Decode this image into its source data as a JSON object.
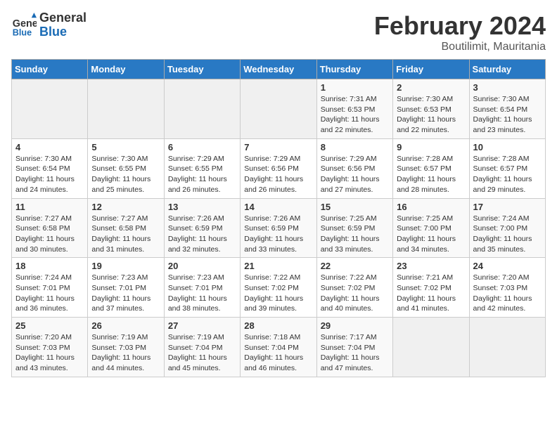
{
  "header": {
    "logo_line1": "General",
    "logo_line2": "Blue",
    "month_title": "February 2024",
    "location": "Boutilimit, Mauritania"
  },
  "days_of_week": [
    "Sunday",
    "Monday",
    "Tuesday",
    "Wednesday",
    "Thursday",
    "Friday",
    "Saturday"
  ],
  "weeks": [
    [
      {
        "day": "",
        "empty": true
      },
      {
        "day": "",
        "empty": true
      },
      {
        "day": "",
        "empty": true
      },
      {
        "day": "",
        "empty": true
      },
      {
        "day": "1",
        "sunrise": "7:31 AM",
        "sunset": "6:53 PM",
        "daylight": "11 hours and 22 minutes."
      },
      {
        "day": "2",
        "sunrise": "7:30 AM",
        "sunset": "6:53 PM",
        "daylight": "11 hours and 22 minutes."
      },
      {
        "day": "3",
        "sunrise": "7:30 AM",
        "sunset": "6:54 PM",
        "daylight": "11 hours and 23 minutes."
      }
    ],
    [
      {
        "day": "4",
        "sunrise": "7:30 AM",
        "sunset": "6:54 PM",
        "daylight": "11 hours and 24 minutes."
      },
      {
        "day": "5",
        "sunrise": "7:30 AM",
        "sunset": "6:55 PM",
        "daylight": "11 hours and 25 minutes."
      },
      {
        "day": "6",
        "sunrise": "7:29 AM",
        "sunset": "6:55 PM",
        "daylight": "11 hours and 26 minutes."
      },
      {
        "day": "7",
        "sunrise": "7:29 AM",
        "sunset": "6:56 PM",
        "daylight": "11 hours and 26 minutes."
      },
      {
        "day": "8",
        "sunrise": "7:29 AM",
        "sunset": "6:56 PM",
        "daylight": "11 hours and 27 minutes."
      },
      {
        "day": "9",
        "sunrise": "7:28 AM",
        "sunset": "6:57 PM",
        "daylight": "11 hours and 28 minutes."
      },
      {
        "day": "10",
        "sunrise": "7:28 AM",
        "sunset": "6:57 PM",
        "daylight": "11 hours and 29 minutes."
      }
    ],
    [
      {
        "day": "11",
        "sunrise": "7:27 AM",
        "sunset": "6:58 PM",
        "daylight": "11 hours and 30 minutes."
      },
      {
        "day": "12",
        "sunrise": "7:27 AM",
        "sunset": "6:58 PM",
        "daylight": "11 hours and 31 minutes."
      },
      {
        "day": "13",
        "sunrise": "7:26 AM",
        "sunset": "6:59 PM",
        "daylight": "11 hours and 32 minutes."
      },
      {
        "day": "14",
        "sunrise": "7:26 AM",
        "sunset": "6:59 PM",
        "daylight": "11 hours and 33 minutes."
      },
      {
        "day": "15",
        "sunrise": "7:25 AM",
        "sunset": "6:59 PM",
        "daylight": "11 hours and 33 minutes."
      },
      {
        "day": "16",
        "sunrise": "7:25 AM",
        "sunset": "7:00 PM",
        "daylight": "11 hours and 34 minutes."
      },
      {
        "day": "17",
        "sunrise": "7:24 AM",
        "sunset": "7:00 PM",
        "daylight": "11 hours and 35 minutes."
      }
    ],
    [
      {
        "day": "18",
        "sunrise": "7:24 AM",
        "sunset": "7:01 PM",
        "daylight": "11 hours and 36 minutes."
      },
      {
        "day": "19",
        "sunrise": "7:23 AM",
        "sunset": "7:01 PM",
        "daylight": "11 hours and 37 minutes."
      },
      {
        "day": "20",
        "sunrise": "7:23 AM",
        "sunset": "7:01 PM",
        "daylight": "11 hours and 38 minutes."
      },
      {
        "day": "21",
        "sunrise": "7:22 AM",
        "sunset": "7:02 PM",
        "daylight": "11 hours and 39 minutes."
      },
      {
        "day": "22",
        "sunrise": "7:22 AM",
        "sunset": "7:02 PM",
        "daylight": "11 hours and 40 minutes."
      },
      {
        "day": "23",
        "sunrise": "7:21 AM",
        "sunset": "7:02 PM",
        "daylight": "11 hours and 41 minutes."
      },
      {
        "day": "24",
        "sunrise": "7:20 AM",
        "sunset": "7:03 PM",
        "daylight": "11 hours and 42 minutes."
      }
    ],
    [
      {
        "day": "25",
        "sunrise": "7:20 AM",
        "sunset": "7:03 PM",
        "daylight": "11 hours and 43 minutes."
      },
      {
        "day": "26",
        "sunrise": "7:19 AM",
        "sunset": "7:03 PM",
        "daylight": "11 hours and 44 minutes."
      },
      {
        "day": "27",
        "sunrise": "7:19 AM",
        "sunset": "7:04 PM",
        "daylight": "11 hours and 45 minutes."
      },
      {
        "day": "28",
        "sunrise": "7:18 AM",
        "sunset": "7:04 PM",
        "daylight": "11 hours and 46 minutes."
      },
      {
        "day": "29",
        "sunrise": "7:17 AM",
        "sunset": "7:04 PM",
        "daylight": "11 hours and 47 minutes."
      },
      {
        "day": "",
        "empty": true
      },
      {
        "day": "",
        "empty": true
      }
    ]
  ],
  "labels": {
    "sunrise": "Sunrise:",
    "sunset": "Sunset:",
    "daylight": "Daylight:"
  }
}
